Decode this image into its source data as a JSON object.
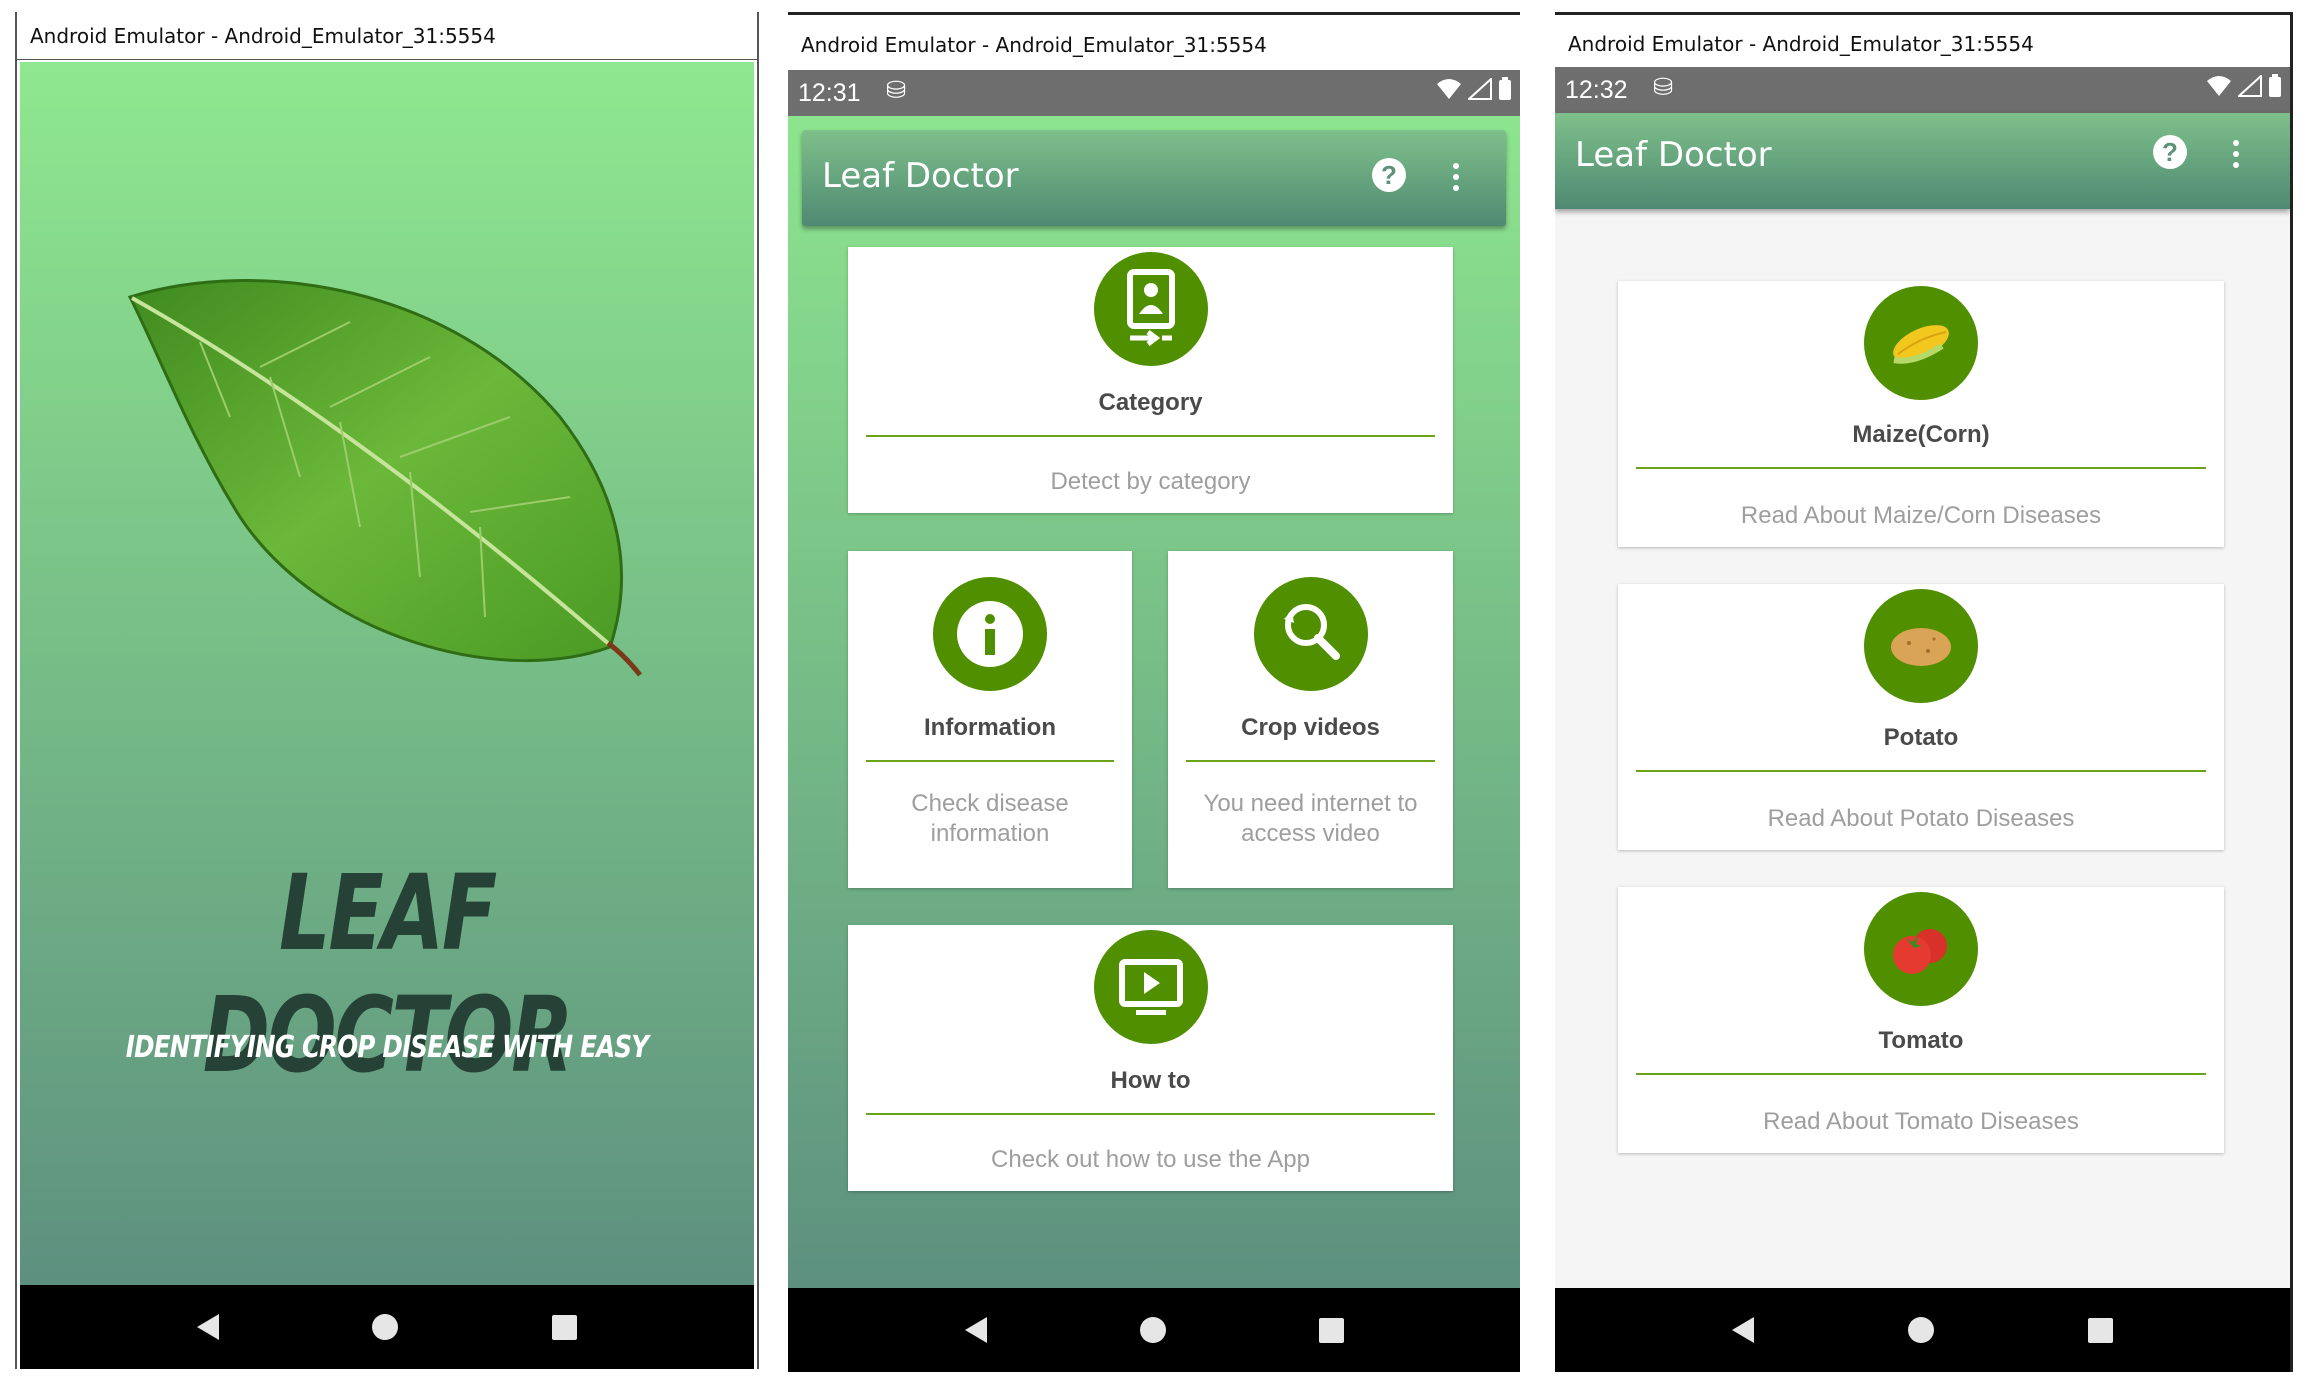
{
  "emulator_title": "Android Emulator - Android_Emulator_31:5554",
  "splash": {
    "app_name": "LEAF DOCTOR",
    "tagline": "IDENTIFYING CROP DISEASE WITH EASY"
  },
  "home": {
    "time": "12:31",
    "app_title": "Leaf Doctor",
    "cards": [
      {
        "title": "Category",
        "subtitle": "Detect by category",
        "icon": "category-icon"
      },
      {
        "title": "Information",
        "subtitle": "Check disease information",
        "icon": "info-icon"
      },
      {
        "title": "Crop videos",
        "subtitle": "You need internet to access video",
        "icon": "video-search-icon"
      },
      {
        "title": "How to",
        "subtitle": "Check out how to use the App",
        "icon": "play-screen-icon"
      }
    ]
  },
  "category": {
    "time": "12:32",
    "app_title": "Leaf Doctor",
    "items": [
      {
        "title": "Maize(Corn)",
        "subtitle": "Read About Maize/Corn Diseases",
        "icon": "corn-icon"
      },
      {
        "title": "Potato",
        "subtitle": "Read About Potato Diseases",
        "icon": "potato-icon"
      },
      {
        "title": "Tomato",
        "subtitle": "Read About Tomato Diseases",
        "icon": "tomato-icon"
      }
    ]
  },
  "colors": {
    "accent_green": "#4f8f00",
    "divider_green": "#6aa21a",
    "gradient_top": "#8fe88f",
    "gradient_bottom": "#5a8a7e",
    "logo_text": "#264236"
  }
}
